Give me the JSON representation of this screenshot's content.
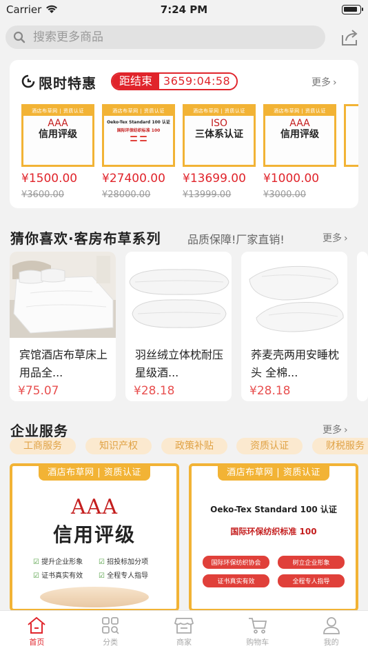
{
  "status_bar": {
    "carrier": "Carrier",
    "time": "7:24 PM"
  },
  "search": {
    "placeholder": "搜索更多商品"
  },
  "flash_sale": {
    "title": "限时特惠",
    "countdown_label": "距结束",
    "countdown_value": "3659:04:58",
    "more_label": "更多",
    "items": [
      {
        "cert_band": "酒店布草网 | 资质认证",
        "cert_big": "AAA",
        "cert_sub": "信用评级",
        "price": "¥1500.00",
        "old_price": "¥3600.00"
      },
      {
        "cert_band": "酒店布草网 | 资质认证",
        "cert_big": "Oeko-Tex Standard 100 认证",
        "cert_sub": "国际环保纺织标准 100",
        "price": "¥27400.00",
        "old_price": "¥28000.00"
      },
      {
        "cert_band": "酒店布草网 | 资质认证",
        "cert_big": "ISO",
        "cert_sub": "三体系认证",
        "price": "¥13699.00",
        "old_price": "¥13999.00"
      },
      {
        "cert_band": "酒店布草网 | 资质认证",
        "cert_big": "AAA",
        "cert_sub": "信用评级",
        "price": "¥1000.00",
        "old_price": "¥3000.00"
      }
    ]
  },
  "guess": {
    "title": "猜你喜欢·客房布草系列",
    "subtitle": "品质保障!厂家直销!",
    "more_label": "更多",
    "products": [
      {
        "name": "宾馆酒店布草床上用品全...",
        "price": "¥75.07"
      },
      {
        "name": "羽丝绒立体枕耐压星级酒...",
        "price": "¥28.18"
      },
      {
        "name": "荞麦壳两用安睡枕头 全棉...",
        "price": "¥28.18"
      }
    ]
  },
  "enterprise": {
    "title": "企业服务",
    "more_label": "更多",
    "tags": [
      "工商服务",
      "知识产权",
      "政策补贴",
      "资质认证",
      "财税服务"
    ],
    "cards": [
      {
        "band": "酒店布草网 | 资质认证",
        "big": "AAA",
        "sub": "信用评级",
        "lines": [
          "提升企业形象",
          "招投标加分项",
          "证书真实有效",
          "全程专人指导"
        ]
      },
      {
        "band": "酒店布草网 | 资质认证",
        "big": "Oeko-Tex Standard 100 认证",
        "sub": "国际环保纺织标准 100",
        "lines": [
          "国际环保纺织协会",
          "树立企业形象",
          "证书真实有效",
          "全程专人指导"
        ]
      }
    ]
  },
  "tabbar": {
    "items": [
      {
        "label": "首页",
        "icon": "home-icon",
        "active": true
      },
      {
        "label": "分类",
        "icon": "category-icon",
        "active": false
      },
      {
        "label": "商家",
        "icon": "store-icon",
        "active": false
      },
      {
        "label": "购物车",
        "icon": "cart-icon",
        "active": false
      },
      {
        "label": "我的",
        "icon": "profile-icon",
        "active": false
      }
    ]
  },
  "colors": {
    "accent": "#e0242b",
    "gold": "#f2b335",
    "tag_bg": "#fbe9cf",
    "tag_text": "#e0a245"
  }
}
